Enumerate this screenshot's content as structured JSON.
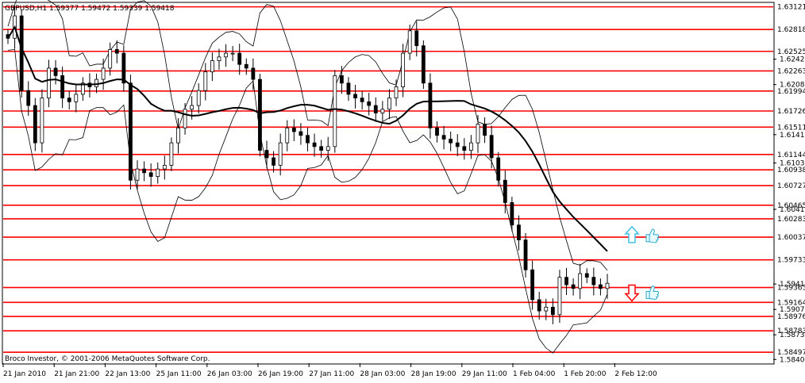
{
  "chart_data": {
    "type": "candlestick",
    "header": "GBPUSD,H1  1.59377 1.59472 1.59339 1.59418",
    "copyright": "Broco Investor, © 2001-2006 MetaQuotes Software Corp.",
    "ylim": [
      1.5835,
      1.6317
    ],
    "x_ticks": [
      "21 Jan 2010",
      "21 Jan 21:00",
      "22 Jan 13:00",
      "25 Jan 11:00",
      "26 Jan 03:00",
      "26 Jan 19:00",
      "27 Jan 11:00",
      "28 Jan 03:00",
      "28 Jan 19:00",
      "29 Jan 11:00",
      "1 Feb 04:00",
      "1 Feb 20:00",
      "2 Feb 12:00"
    ],
    "y_ticks": [
      1.6242,
      1.6208,
      1.6141,
      1.6103,
      1.6041,
      1.5941,
      1.5907,
      1.5873,
      1.584
    ],
    "levels": [
      1.63121,
      1.62818,
      1.62525,
      1.62263,
      1.61994,
      1.61726,
      1.61511,
      1.61144,
      1.60938,
      1.60727,
      1.60465,
      1.60283,
      1.60037,
      1.59733,
      1.59363,
      1.59164,
      1.58976,
      1.58783,
      1.58497
    ],
    "level_labels": [
      "1.63121",
      "1.62818",
      "1.62525",
      "1.62263",
      "1.61994",
      "1.61726",
      "1.61511",
      "1.61144",
      "1.60938",
      "1.60727",
      "1.60465",
      "1.60283",
      "1.60037",
      "1.59733",
      "1.59363",
      "1.59164",
      "1.58976",
      "1.58783",
      "1.58497"
    ],
    "level_color": "#ff0000",
    "grid": false,
    "ma_color": "#000000",
    "band_color": "#000000",
    "candle_color": "#000000",
    "closes": [
      1.627,
      1.63,
      1.62,
      1.618,
      1.613,
      1.619,
      1.623,
      1.622,
      1.619,
      1.6185,
      1.6195,
      1.621,
      1.6205,
      1.6215,
      1.623,
      1.6255,
      1.625,
      1.621,
      1.608,
      1.6095,
      1.609,
      1.6085,
      1.6095,
      1.61,
      1.613,
      1.615,
      1.6175,
      1.618,
      1.62,
      1.6225,
      1.624,
      1.6245,
      1.625,
      1.625,
      1.6235,
      1.623,
      1.6215,
      1.612,
      1.611,
      1.61,
      1.613,
      1.615,
      1.6145,
      1.614,
      1.613,
      1.6125,
      1.612,
      1.6125,
      1.622,
      1.621,
      1.6195,
      1.619,
      1.6185,
      1.618,
      1.617,
      1.6175,
      1.619,
      1.6205,
      1.625,
      1.628,
      1.626,
      1.621,
      1.615,
      1.614,
      1.6135,
      1.613,
      1.6125,
      1.612,
      1.613,
      1.6155,
      1.614,
      1.611,
      1.608,
      1.605,
      1.602,
      1.6,
      1.596,
      1.592,
      1.5905,
      1.591,
      1.59,
      1.595,
      1.594,
      1.5935,
      1.5955,
      1.595,
      1.594,
      1.5935,
      1.5942
    ],
    "arrows": [
      {
        "direction": "up",
        "price": 1.6006,
        "color": "#40c0e0"
      },
      {
        "direction": "down",
        "price": 1.593,
        "color": "#ff0000"
      }
    ],
    "signal_icons": [
      {
        "name": "thumbs-up",
        "price": 1.6006
      },
      {
        "name": "thumbs-up",
        "price": 1.593
      }
    ]
  }
}
